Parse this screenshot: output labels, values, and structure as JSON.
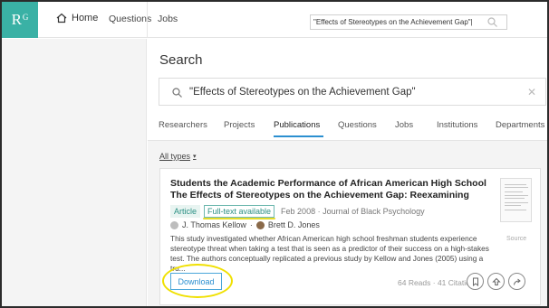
{
  "nav": {
    "logo": "R",
    "logo_sup": "G",
    "home": "Home",
    "questions": "Questions",
    "jobs": "Jobs",
    "search_value": "\"Effects of Stereotypes on the Achievement Gap\"|"
  },
  "search": {
    "title": "Search",
    "query": "\"Effects of Stereotypes on the Achievement Gap\""
  },
  "tabs": [
    "Researchers",
    "Projects",
    "Publications",
    "Questions",
    "Jobs",
    "Institutions",
    "Departments"
  ],
  "active_tab": "Publications",
  "filter": {
    "label": "All types",
    "caret": "▾"
  },
  "result": {
    "title": "Students the Academic Performance of African American High School The Effects of Stereotypes on the Achievement Gap: Reexamining",
    "type_badge": "Article",
    "fulltext_badge": "Full-text available",
    "date_journal": "Feb 2008 · Journal of Black Psychology",
    "author1": "J. Thomas Kellow",
    "author_sep": "·",
    "author2": "Brett D. Jones",
    "abstract": "This study investigated whether African American high school freshman students experience stereotype threat when taking a test that is seen as a predictor of their success on a high-stakes test. The authors conceptually replicated a previous study by Kellow and Jones (2005) using a tru...",
    "source_label": "Source",
    "download_label": "Download",
    "stats": "64 Reads · 41 Citations"
  },
  "colors": {
    "brand": "#3ab1a5",
    "accent_blue": "#2b8fd0",
    "highlight_yellow": "#f0e000"
  },
  "icons": [
    "home-icon",
    "search-icon",
    "close-icon",
    "bookmark-icon",
    "upvote-icon",
    "share-icon"
  ]
}
